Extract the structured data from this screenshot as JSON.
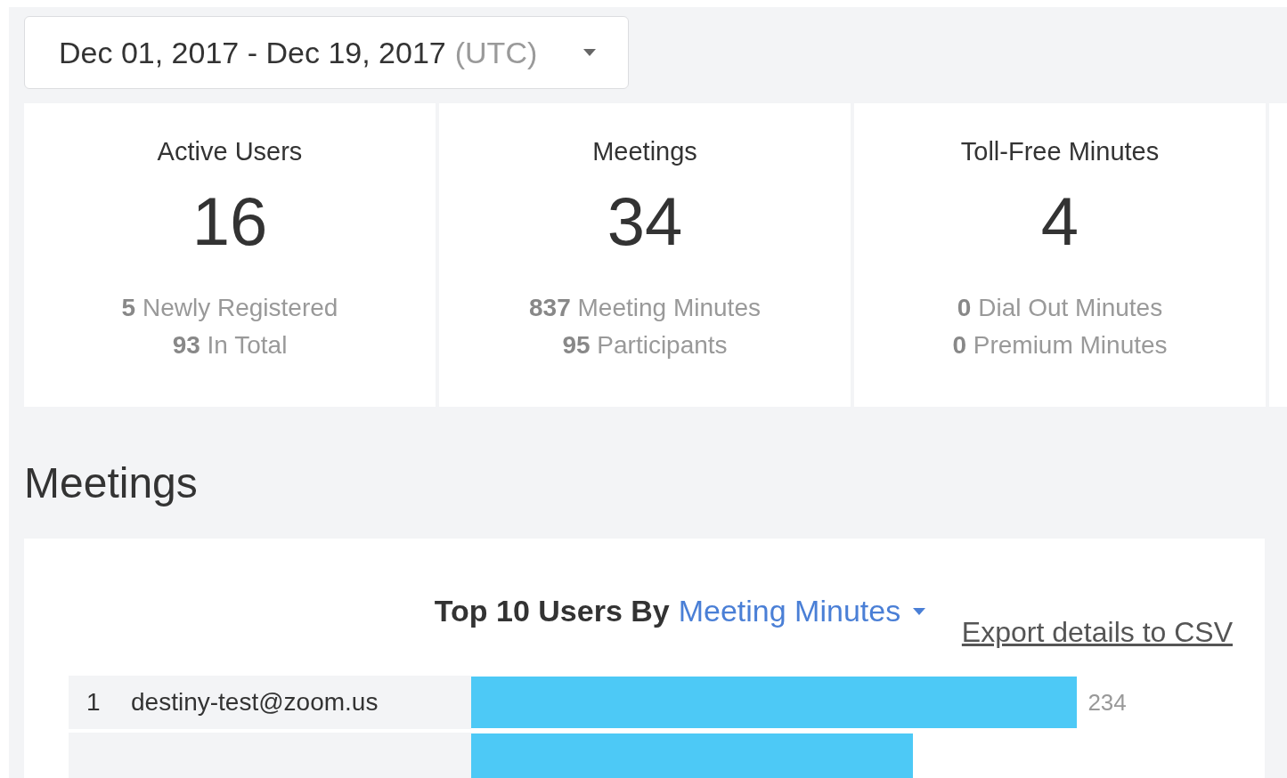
{
  "date_range": {
    "value": "Dec 01, 2017 - Dec 19, 2017",
    "timezone": "(UTC)"
  },
  "stats": [
    {
      "title": "Active Users",
      "value": "16",
      "details": [
        "**5** Newly Registered",
        "**93** In Total"
      ]
    },
    {
      "title": "Meetings",
      "value": "34",
      "details": [
        "**837** Meeting Minutes",
        "**95** Participants"
      ]
    },
    {
      "title": "Toll-Free Minutes",
      "value": "4",
      "details": [
        "**0** Dial Out Minutes",
        "**0** Premium Minutes"
      ]
    }
  ],
  "section_title": "Meetings",
  "top_users": {
    "title": "Top 10 Users By",
    "metric": "Meeting Minutes",
    "export_link": "Export details to CSV",
    "rows": [
      {
        "rank": "1",
        "name": "destiny-test@zoom.us",
        "value": "234",
        "level": 0.81
      },
      {
        "level": 0.59
      }
    ]
  }
}
